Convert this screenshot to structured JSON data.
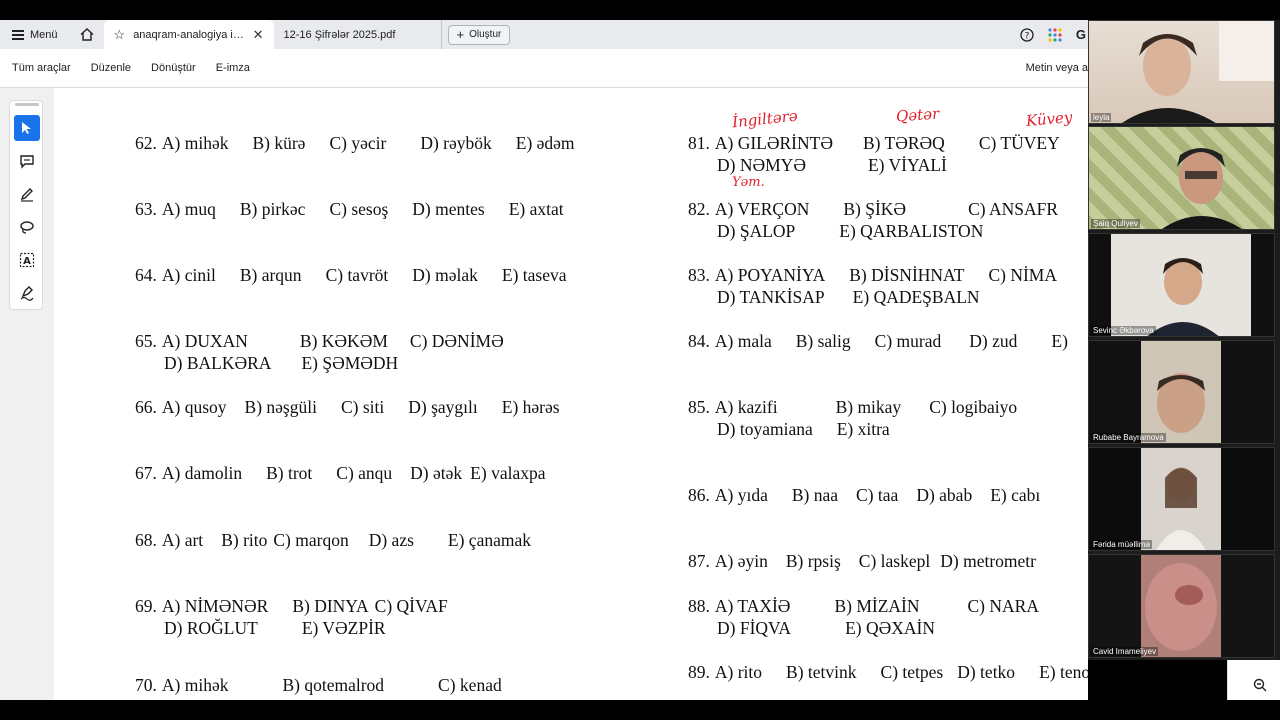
{
  "browser": {
    "menu_label": "Menü",
    "tabs": [
      {
        "title": "anaqram-analogiya ilk...",
        "active": true
      },
      {
        "title": "12-16 Şifrələr 2025.pdf",
        "active": false
      }
    ],
    "create_label": "Oluştur",
    "profile_letter": "G"
  },
  "toolbar": {
    "items": [
      "Tüm araçlar",
      "Düzenle",
      "Dönüştür",
      "E-imza"
    ],
    "search_label": "Metin veya a"
  },
  "questions": [
    {
      "num": "62.",
      "line1": [
        "A) mihək",
        "B) kürə",
        "C) yəcir",
        "D) rəybök",
        "E) ədəm"
      ]
    },
    {
      "num": "63.",
      "line1": [
        "A) muq",
        "B) pirkəc",
        "C) sesoş",
        "D) mentes",
        "E) axtat"
      ]
    },
    {
      "num": "64.",
      "line1": [
        "A) cinil",
        "B) arqun",
        "C) tavröt",
        "D) məlak",
        "E) taseva"
      ]
    },
    {
      "num": "65.",
      "line1": [
        "A) DUXAN",
        "B) KƏKƏM",
        "C) DƏNİMƏ"
      ],
      "line2": [
        "D) BALKƏRA",
        "E) ŞƏMƏDH"
      ]
    },
    {
      "num": "66.",
      "line1": [
        "A) qusoy",
        "B) nəşgüli",
        "C) siti",
        "D) şaygılı",
        "E) hərəs"
      ]
    },
    {
      "num": "67.",
      "line1": [
        "A) damolin",
        "B) trot",
        "C) anqu",
        "D) ətək",
        "E) valaxpa"
      ]
    },
    {
      "num": "68.",
      "line1": [
        "A) art",
        "B) rito",
        "C) marqon",
        "D) azs",
        "E) çanamak"
      ]
    },
    {
      "num": "69.",
      "line1": [
        "A) NİMƏNƏR",
        "B) DINYA",
        "C) QİVAF"
      ],
      "line2": [
        "D) ROĞLUT",
        "E) VƏZPİR"
      ]
    },
    {
      "num": "70.",
      "line1": [
        "A) mihək",
        "B) qotemalrod",
        "C) kenad"
      ]
    },
    {
      "num": "81.",
      "line1": [
        "A) GILƏRİNTƏ",
        "B) TƏRƏQ",
        "C) TÜVEY"
      ],
      "line2": [
        "D) NƏMYƏ",
        "E) VİYALİ"
      ]
    },
    {
      "num": "82.",
      "line1": [
        "A) VERÇON",
        "B) ŞİKƏ",
        "C) ANSAFR"
      ],
      "line2": [
        "D) ŞALOP",
        "E) QARBALISTON"
      ]
    },
    {
      "num": "83.",
      "line1": [
        "A) POYANİYA",
        "B) DİSNİHNAT",
        "C) NİMA"
      ],
      "line2": [
        "D) TANKİSAP",
        "E) QADEŞBALN"
      ]
    },
    {
      "num": "84.",
      "line1": [
        "A) mala",
        "B) salig",
        "C) murad",
        "D) zud",
        "E)"
      ]
    },
    {
      "num": "85.",
      "line1": [
        "A) kazifi",
        "B) mikay",
        "C) logibaiyo"
      ],
      "line2": [
        "D) toyamiana",
        "E) xitra"
      ]
    },
    {
      "num": "86.",
      "line1": [
        "A) yıda",
        "B) naa",
        "C) taa",
        "D) abab",
        "E) cabı"
      ]
    },
    {
      "num": "87.",
      "line1": [
        "A) əyin",
        "B) rpsiş",
        "C) laskepl",
        "D) metrometr"
      ]
    },
    {
      "num": "88.",
      "line1": [
        "A) TAXİƏ",
        "B) MİZAİN",
        "C) NARA"
      ],
      "line2": [
        "D) FİQVA",
        "E) QƏXAİN"
      ]
    },
    {
      "num": "89.",
      "line1": [
        "A) rito",
        "B) tetvink",
        "C) tetpes",
        "D) tetko",
        "E) tenon"
      ]
    }
  ],
  "annotations": [
    "İngiltərə",
    "Qətər",
    "Küvey",
    "Yəm."
  ],
  "participants": [
    "leyla",
    "Şaiq Quliyev",
    "Sevinc Əkbərova",
    "Rubabe Bayramova",
    "Fərida müəllimə",
    "Cavid Imameliyev"
  ],
  "colors": {
    "ink": "#e0202a",
    "accent": "#1a73e8",
    "tabbar": "#e8eaed"
  }
}
